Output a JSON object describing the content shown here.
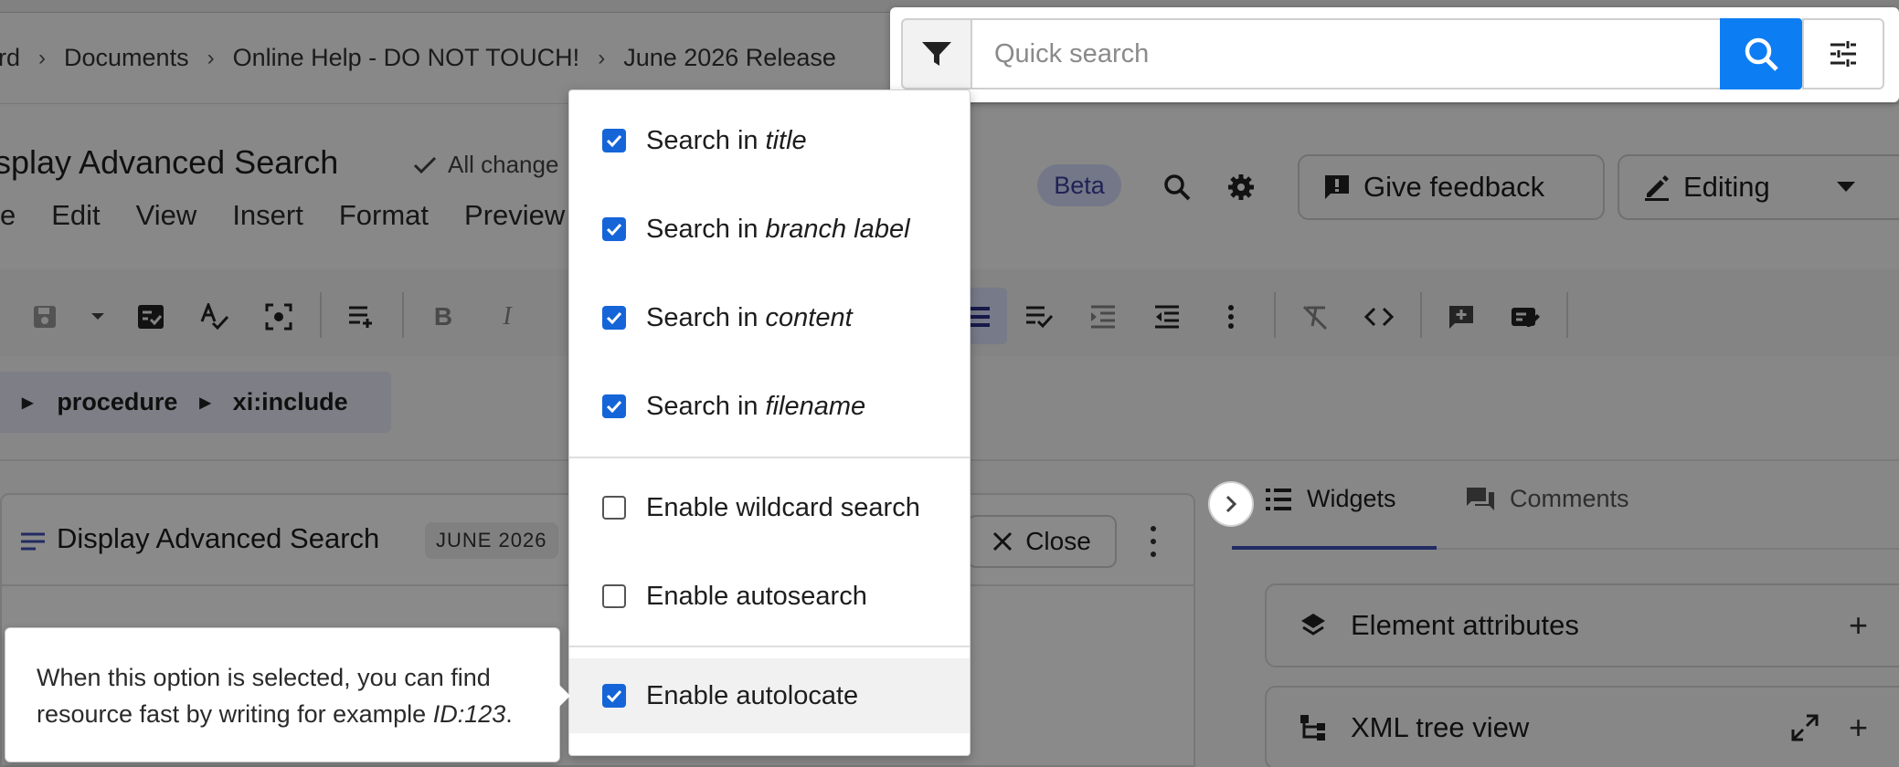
{
  "breadcrumb": [
    "rd",
    "Documents",
    "Online Help - DO NOT TOUCH!",
    "June 2026 Release"
  ],
  "breadcrumb_separator": "›",
  "document": {
    "title": "splay Advanced Search",
    "save_status": "All change"
  },
  "menu": [
    "e",
    "Edit",
    "View",
    "Insert",
    "Format",
    "Preview"
  ],
  "header": {
    "beta_label": "Beta",
    "feedback_label": "Give feedback",
    "editing_label": "Editing"
  },
  "element_path": [
    "procedure",
    "xi:include"
  ],
  "editor": {
    "title": "Display Advanced Search",
    "badge": "JUNE 2026",
    "close_label": "Close"
  },
  "side_panel": {
    "tabs": [
      "Widgets",
      "Comments"
    ],
    "widgets": [
      "Element attributes",
      "XML tree view"
    ],
    "plus": "+"
  },
  "search": {
    "placeholder": "Quick search",
    "options": [
      {
        "prefix": "Search in",
        "emphasis": "title",
        "checked": true
      },
      {
        "prefix": "Search in",
        "emphasis": "branch label",
        "checked": true
      },
      {
        "prefix": "Search in",
        "emphasis": "content",
        "checked": true
      },
      {
        "prefix": "Search in",
        "emphasis": "filename",
        "checked": true
      }
    ],
    "toggles": [
      {
        "label": "Enable wildcard search",
        "checked": false
      },
      {
        "label": "Enable autosearch",
        "checked": false
      },
      {
        "label": "Enable autolocate",
        "checked": true
      }
    ]
  },
  "tooltip": {
    "text": "When this option is selected, you can find resource fast by writing for example",
    "example": "ID:123",
    "end": "."
  },
  "colors": {
    "primary_blue": "#0d7df3",
    "checkbox_blue": "#1565d8",
    "tab_underline": "#3f51b5",
    "beta_bg": "#d7dcfb"
  },
  "icons": [
    "filter-icon",
    "search-icon",
    "sliders-icon",
    "check-icon",
    "gear-icon",
    "feedback-icon",
    "pencil-icon",
    "chevron-right-icon",
    "close-icon",
    "list-icon",
    "comments-icon",
    "layers-icon",
    "tree-icon",
    "expand-icon"
  ]
}
